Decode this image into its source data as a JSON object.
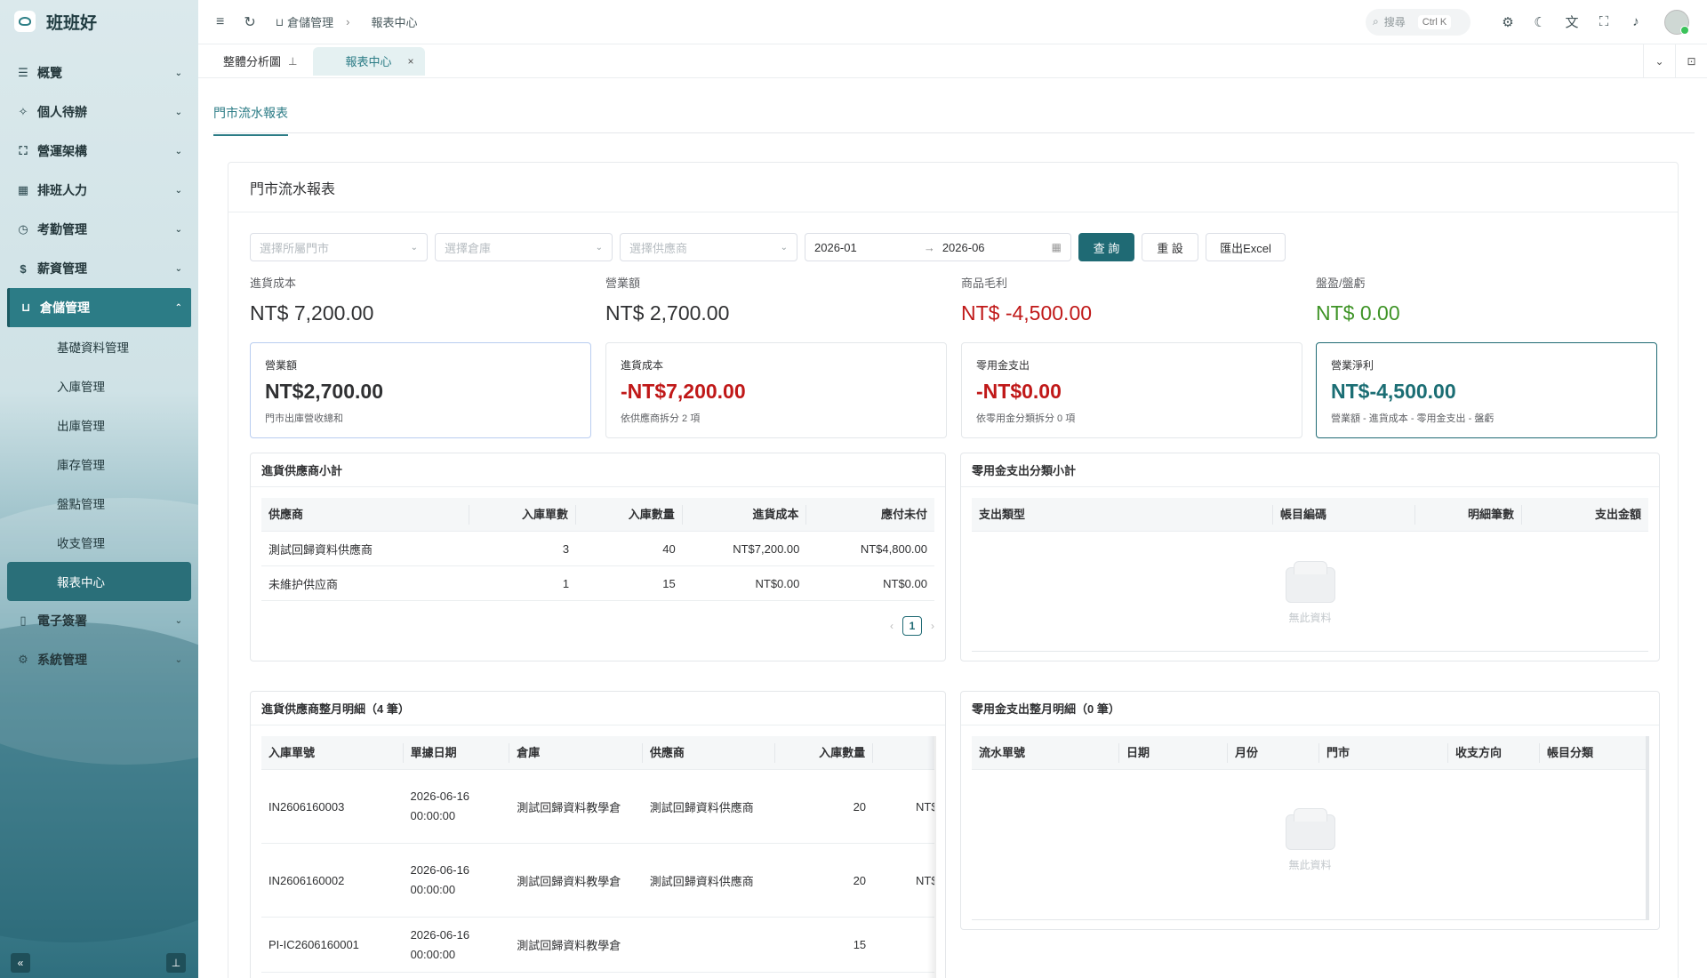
{
  "app": {
    "name": "班班好"
  },
  "sidebar": {
    "items": [
      {
        "label": "概覽",
        "icon": "☰",
        "name": "overview"
      },
      {
        "label": "個人待辦",
        "icon": "✧",
        "name": "todo"
      },
      {
        "label": "營運架構",
        "icon": "⛶",
        "name": "structure"
      },
      {
        "label": "排班人力",
        "icon": "▦",
        "name": "schedule"
      },
      {
        "label": "考勤管理",
        "icon": "◷",
        "name": "attendance"
      },
      {
        "label": "薪資管理",
        "icon": "$",
        "name": "salary"
      }
    ],
    "open_item": {
      "label": "倉儲管理",
      "icon": "⊔"
    },
    "sub_items": [
      "基礎資料管理",
      "入庫管理",
      "出庫管理",
      "庫存管理",
      "盤點管理",
      "收支管理",
      "報表中心"
    ],
    "after_items": [
      {
        "label": "電子簽署",
        "icon": "▯",
        "name": "esign"
      },
      {
        "label": "系統管理",
        "icon": "⚙",
        "name": "system"
      }
    ]
  },
  "topbar": {
    "breadcrumb_1": "倉儲管理",
    "breadcrumb_2": "報表中心",
    "search_placeholder": "搜尋",
    "search_shortcut": "Ctrl K"
  },
  "tabs": {
    "tab1": "整體分析圖",
    "tab2": "報表中心"
  },
  "page": {
    "tab": "門市流水報表",
    "card_title": "門市流水報表"
  },
  "filters": {
    "store_placeholder": "選擇所屬門市",
    "warehouse_placeholder": "選擇倉庫",
    "supplier_placeholder": "選擇供應商",
    "date_start": "2026-01",
    "date_end": "2026-06",
    "query_label": "查 詢",
    "reset_label": "重 設",
    "export_label": "匯出Excel"
  },
  "stats": [
    {
      "label": "進貨成本",
      "value": "NT$ 7,200.00"
    },
    {
      "label": "營業額",
      "value": "NT$ 2,700.00"
    },
    {
      "label": "商品毛利",
      "value": "NT$ -4,500.00"
    },
    {
      "label": "盤盈/盤虧",
      "value": "NT$ 0.00"
    }
  ],
  "kpis": [
    {
      "label": "營業額",
      "value": "NT$2,700.00",
      "desc": "門市出庫營收總和"
    },
    {
      "label": "進貨成本",
      "value": "-NT$7,200.00",
      "desc": "依供應商拆分 2 項"
    },
    {
      "label": "零用金支出",
      "value": "-NT$0.00",
      "desc": "依零用金分類拆分 0 項"
    },
    {
      "label": "營業淨利",
      "value": "NT$-4,500.00",
      "desc": "營業額 - 進貨成本 - 零用金支出 - 盤虧"
    }
  ],
  "supplier_summary": {
    "title": "進貨供應商小計",
    "headers": [
      "供應商",
      "入庫單數",
      "入庫數量",
      "進貨成本",
      "應付未付"
    ],
    "rows": [
      [
        "測試回歸資料供應商",
        "3",
        "40",
        "NT$7,200.00",
        "NT$4,800.00"
      ],
      [
        "未維护供应商",
        "1",
        "15",
        "NT$0.00",
        "NT$0.00"
      ]
    ],
    "page": "1"
  },
  "petty_summary": {
    "title": "零用金支出分類小計",
    "headers": [
      "支出類型",
      "帳目編碼",
      "明細筆數",
      "支出金額"
    ],
    "empty": "無此資料"
  },
  "supplier_detail": {
    "title": "進貨供應商整月明細（4 筆）",
    "headers": [
      "入庫單號",
      "單據日期",
      "倉庫",
      "供應商",
      "入庫數量"
    ],
    "rows": [
      [
        "IN2606160003",
        "2026-06-16",
        "00:00:00",
        "測試回歸資料教學倉",
        "測試回歸資料供應商",
        "20",
        "NT$"
      ],
      [
        "IN2606160002",
        "2026-06-16",
        "00:00:00",
        "測試回歸資料教學倉",
        "測試回歸資料供應商",
        "20",
        "NT$"
      ],
      [
        "PI-IC2606160001",
        "2026-06-16",
        "00:00:00",
        "測試回歸資料教學倉",
        "",
        "15",
        ""
      ]
    ]
  },
  "petty_detail": {
    "title": "零用金支出整月明細（0 筆）",
    "headers": [
      "流水單號",
      "日期",
      "月份",
      "門市",
      "收支方向",
      "帳目分類"
    ],
    "empty": "無此資料"
  }
}
